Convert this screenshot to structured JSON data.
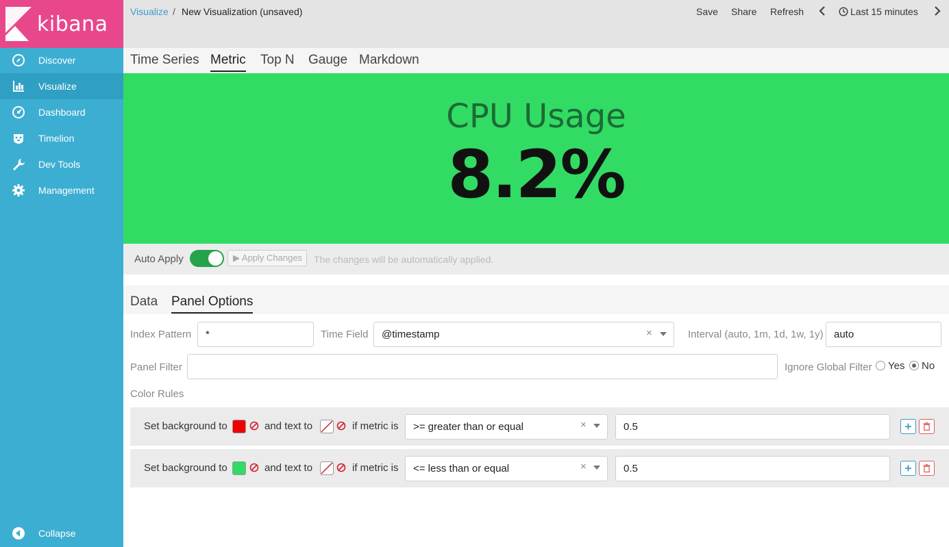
{
  "app": {
    "logo_text": "kibana"
  },
  "sidebar": {
    "items": [
      {
        "label": "Discover",
        "icon": "compass-icon"
      },
      {
        "label": "Visualize",
        "icon": "bar-chart-icon"
      },
      {
        "label": "Dashboard",
        "icon": "dashboard-icon"
      },
      {
        "label": "Timelion",
        "icon": "timelion-icon"
      },
      {
        "label": "Dev Tools",
        "icon": "wrench-icon"
      },
      {
        "label": "Management",
        "icon": "gear-icon"
      }
    ],
    "collapse_label": "Collapse"
  },
  "topbar": {
    "breadcrumb_link": "Visualize",
    "breadcrumb_sep": "/",
    "breadcrumb_current": "New Visualization (unsaved)",
    "save_label": "Save",
    "share_label": "Share",
    "refresh_label": "Refresh",
    "time_label": "Last 15 minutes"
  },
  "type_tabs": [
    "Time Series",
    "Metric",
    "Top N",
    "Gauge",
    "Markdown"
  ],
  "metric": {
    "title": "CPU Usage",
    "value": "8.2%",
    "background": "#32db64"
  },
  "apply_bar": {
    "auto_apply_label": "Auto Apply",
    "apply_changes_label": "▶ Apply Changes",
    "note": "The changes will be automatically applied."
  },
  "options_tabs": [
    "Data",
    "Panel Options"
  ],
  "panel_options": {
    "index_pattern_label": "Index Pattern",
    "index_pattern_value": "*",
    "time_field_label": "Time Field",
    "time_field_value": "@timestamp",
    "interval_label": "Interval (auto, 1m, 1d, 1w, 1y)",
    "interval_value": "auto",
    "panel_filter_label": "Panel Filter",
    "panel_filter_value": "",
    "ignore_global_filter_label": "Ignore Global Filter",
    "yes_label": "Yes",
    "no_label": "No",
    "color_rules_label": "Color Rules"
  },
  "color_rules": [
    {
      "set_bg_label": "Set background to",
      "bg_color": "#f00000",
      "and_text_label": "and text to",
      "if_metric_label": "if metric is",
      "operator": ">= greater than or equal",
      "value": "0.5"
    },
    {
      "set_bg_label": "Set background to",
      "bg_color": "#32db64",
      "and_text_label": "and text to",
      "if_metric_label": "if metric is",
      "operator": "<= less than or equal",
      "value": "0.5"
    }
  ]
}
